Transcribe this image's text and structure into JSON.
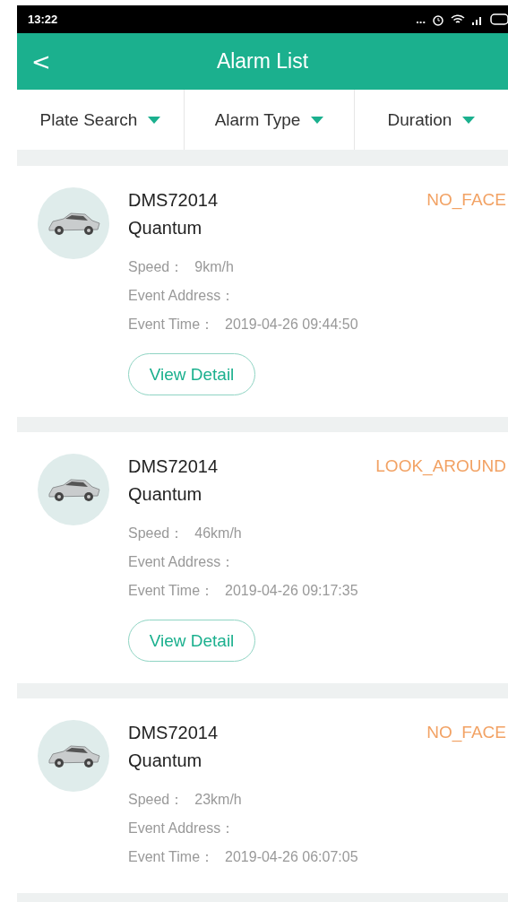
{
  "status_bar": {
    "time": "13:22",
    "dots": "..."
  },
  "header": {
    "back": "<",
    "title": "Alarm List"
  },
  "filters": [
    {
      "label": "Plate Search"
    },
    {
      "label": "Alarm Type"
    },
    {
      "label": "Duration"
    }
  ],
  "alarms": [
    {
      "plate": "DMS72014",
      "model": "Quantum",
      "type": "NO_FACE",
      "speed_label": "Speed：",
      "speed": "9km/h",
      "address_label": "Event Address：",
      "time_label": "Event Time：",
      "time": "2019-04-26 09:44:50",
      "button": "View Detail"
    },
    {
      "plate": "DMS72014",
      "model": "Quantum",
      "type": "LOOK_AROUND",
      "speed_label": "Speed：",
      "speed": "46km/h",
      "address_label": "Event Address：",
      "time_label": "Event Time：",
      "time": "2019-04-26 09:17:35",
      "button": "View Detail"
    },
    {
      "plate": "DMS72014",
      "model": "Quantum",
      "type": "NO_FACE",
      "speed_label": "Speed：",
      "speed": "23km/h",
      "address_label": "Event Address：",
      "time_label": "Event Time：",
      "time": "2019-04-26 06:07:05"
    }
  ]
}
